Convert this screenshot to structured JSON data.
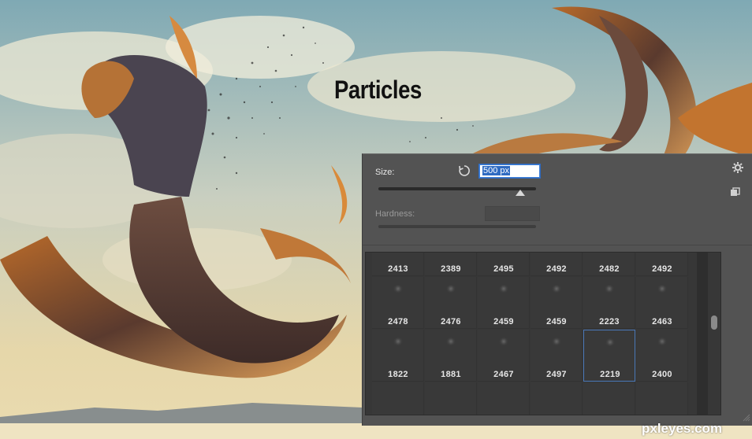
{
  "artwork": {
    "caption": "Particles"
  },
  "brush_panel": {
    "size_label": "Size:",
    "size_value": "500 px",
    "size_slider_fraction": 0.9,
    "hardness_label": "Hardness:",
    "icons": [
      "reset-icon",
      "gear-icon",
      "new-preset-icon"
    ],
    "presets": [
      [
        "2413",
        "2389",
        "2495",
        "2492",
        "2482",
        "2492"
      ],
      [
        "2478",
        "2476",
        "2459",
        "2459",
        "2223",
        "2463"
      ],
      [
        "1822",
        "1881",
        "2467",
        "2497",
        "2219",
        "2400"
      ]
    ],
    "selected_preset": "2219"
  },
  "watermark": "pxleyes.com",
  "colors": {
    "panel_bg": "#535353",
    "grid_bg": "#393939",
    "selection": "#4a78b8",
    "input_highlight": "#2f6bc2"
  }
}
